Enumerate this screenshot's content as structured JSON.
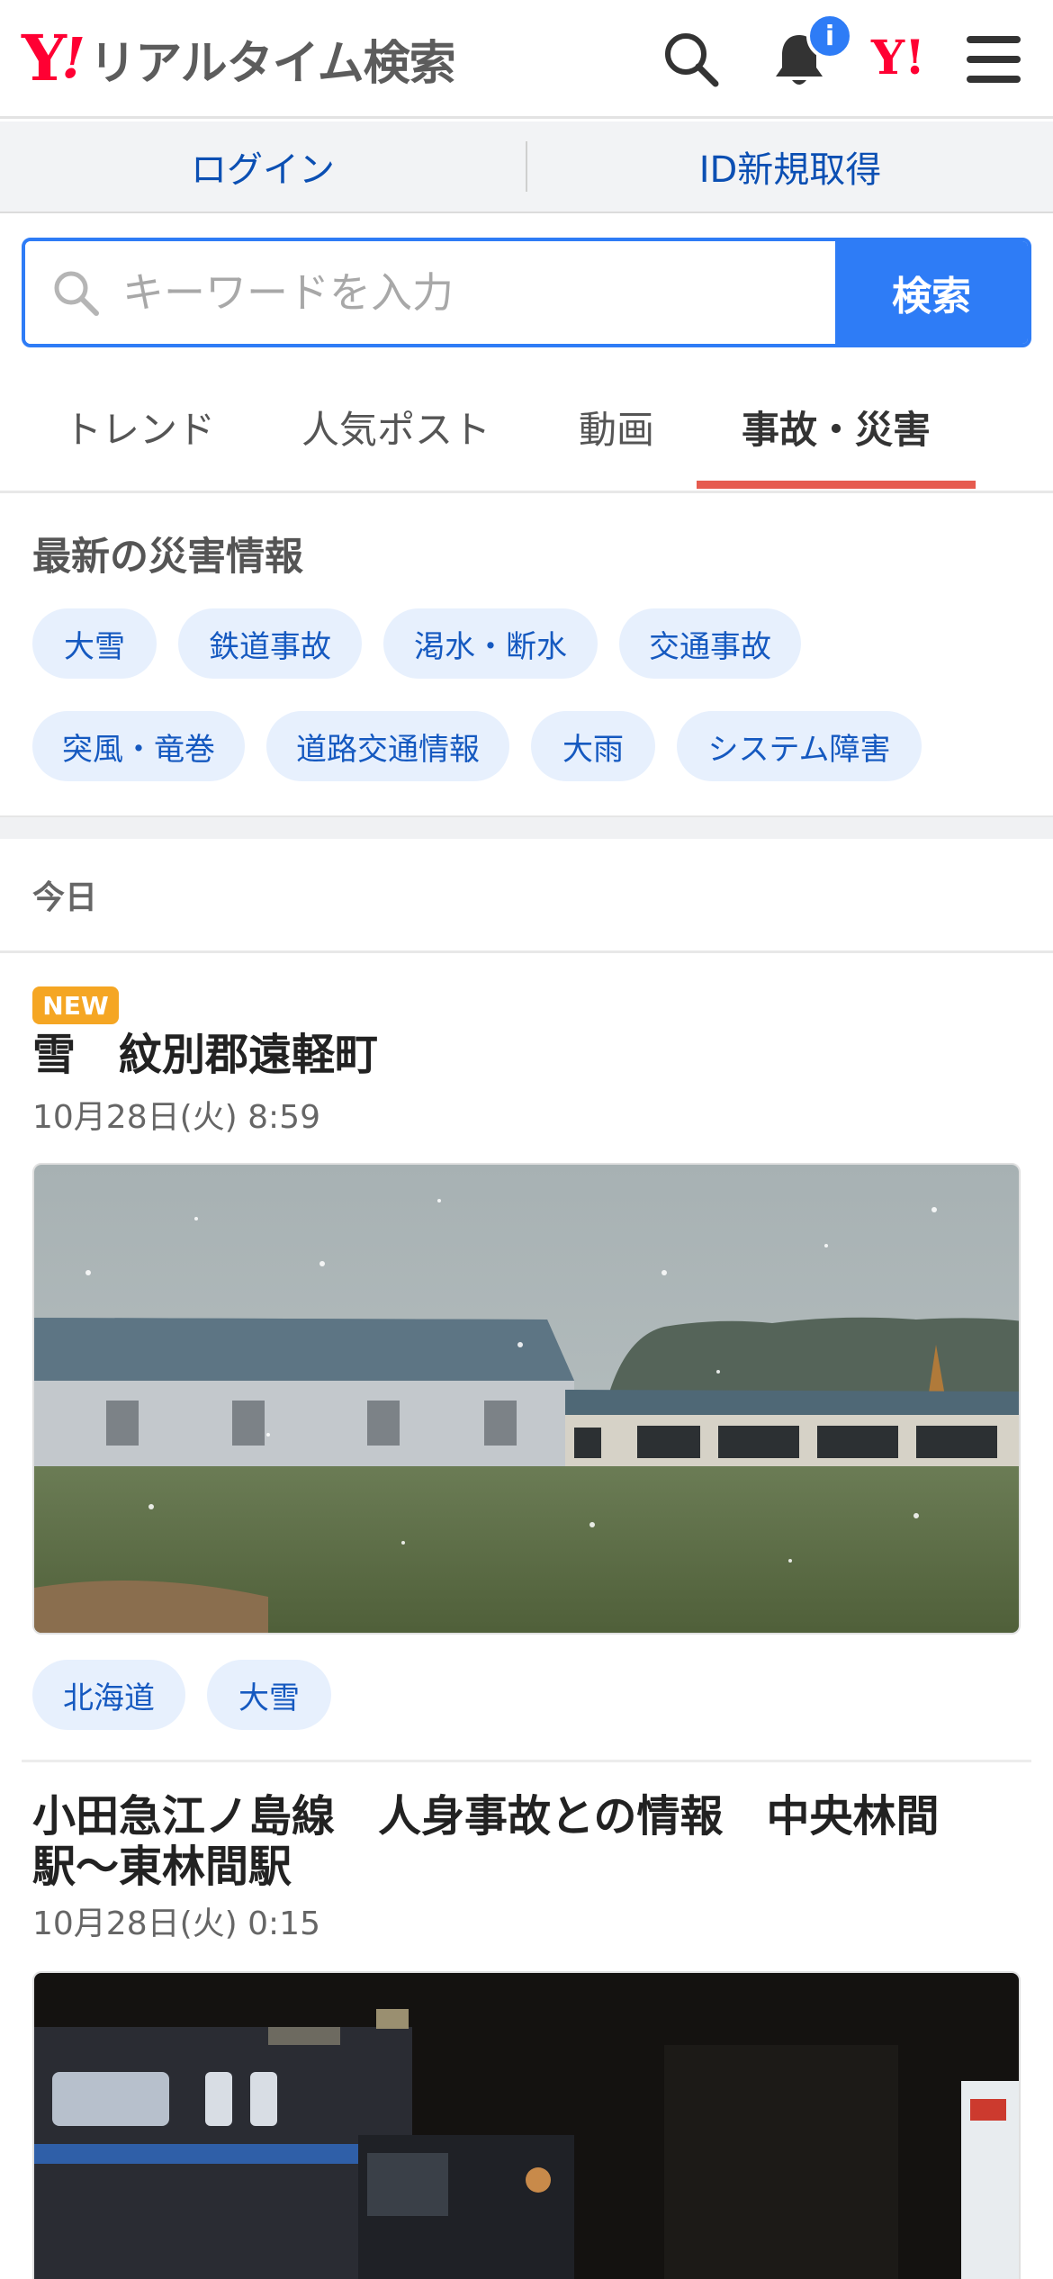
{
  "header": {
    "logo_y": "Y",
    "logo_ex": "!",
    "logo_text": "リアルタイム検索",
    "notification_badge": "i",
    "yj_mark": "Y!",
    "icons": [
      "search-icon",
      "bell-icon",
      "yahoo-japan-icon",
      "menu-icon"
    ]
  },
  "login_bar": {
    "login": "ログイン",
    "register": "ID新規取得"
  },
  "search": {
    "placeholder": "キーワードを入力",
    "button": "検索",
    "value": ""
  },
  "tabs": [
    {
      "label": "トレンド",
      "active": false
    },
    {
      "label": "人気ポスト",
      "active": false
    },
    {
      "label": "動画",
      "active": false
    },
    {
      "label": "事故・災害",
      "active": true
    }
  ],
  "disaster_info": {
    "title": "最新の災害情報",
    "chips": [
      "大雪",
      "鉄道事故",
      "渇水・断水",
      "交通事故",
      "突風・竜巻",
      "道路交通情報",
      "大雨",
      "システム障害"
    ]
  },
  "feed": {
    "section_label": "今日",
    "articles": [
      {
        "new_label": "NEW",
        "title": "雪　紋別郡遠軽町",
        "date": "10月28日(火) 8:59",
        "tags": [
          "北海道",
          "大雪"
        ]
      },
      {
        "title_line1": "小田急江ノ島線　人身事故との情報　中央林間",
        "title_line2": "駅〜東林間駅",
        "date": "10月28日(火) 0:15"
      }
    ]
  },
  "colors": {
    "brand_red": "#ff0033",
    "accent_blue": "#2e7cf6",
    "tab_underline": "#e65b4f",
    "new_badge": "#f5a623",
    "chip_bg": "#e7f0fd"
  }
}
